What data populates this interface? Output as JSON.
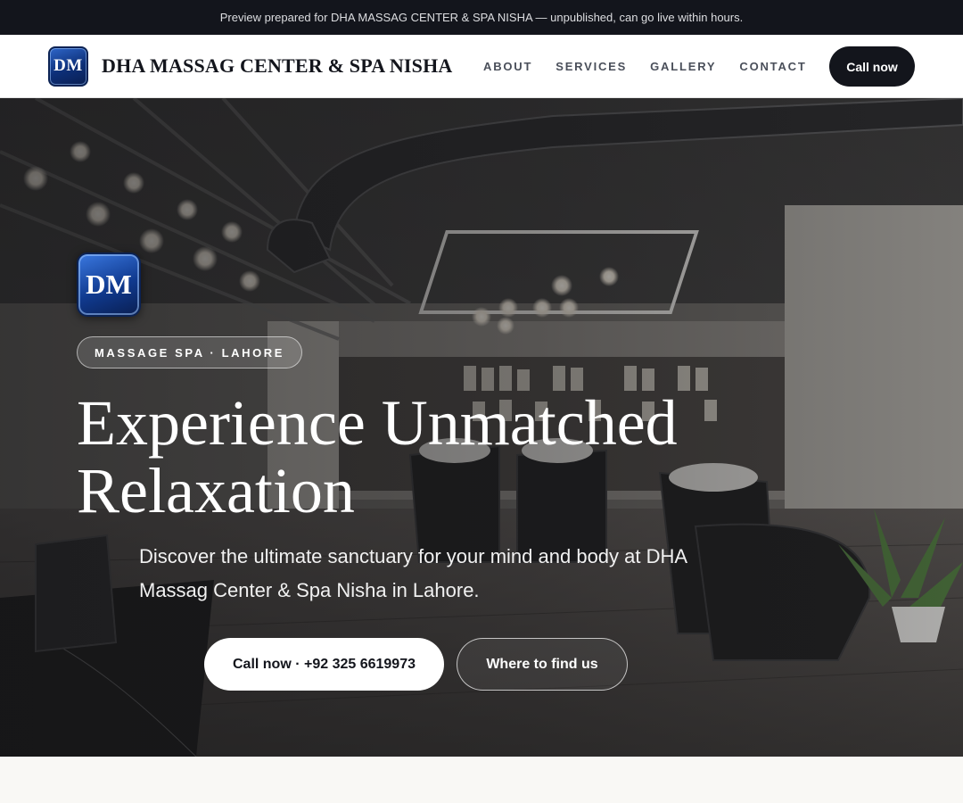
{
  "preview_bar": {
    "text": "Preview prepared for DHA MASSAG CENTER & SPA NISHA — unpublished, can go live within hours."
  },
  "header": {
    "logo_text": "DM",
    "site_name": "DHA MASSAG CENTER & SPA NISHA",
    "nav": [
      {
        "label": "ABOUT"
      },
      {
        "label": "SERVICES"
      },
      {
        "label": "GALLERY"
      },
      {
        "label": "CONTACT"
      }
    ],
    "cta_label": "Call now"
  },
  "hero": {
    "logo_text": "DM",
    "tag": "MASSAGE SPA · LAHORE",
    "title": "Experience Unmatched Relaxation",
    "subtitle": "Discover the ultimate sanctuary for your mind and body at DHA Massag Center & Spa Nisha in Lahore.",
    "primary_button": "Call now · +92 325 6619973",
    "secondary_button": "Where to find us",
    "background_icon": "spa-interior-photo"
  },
  "colors": {
    "dark": "#13151c",
    "logo_blue": "#0d2f78",
    "page_bg": "#f9f8f5"
  }
}
